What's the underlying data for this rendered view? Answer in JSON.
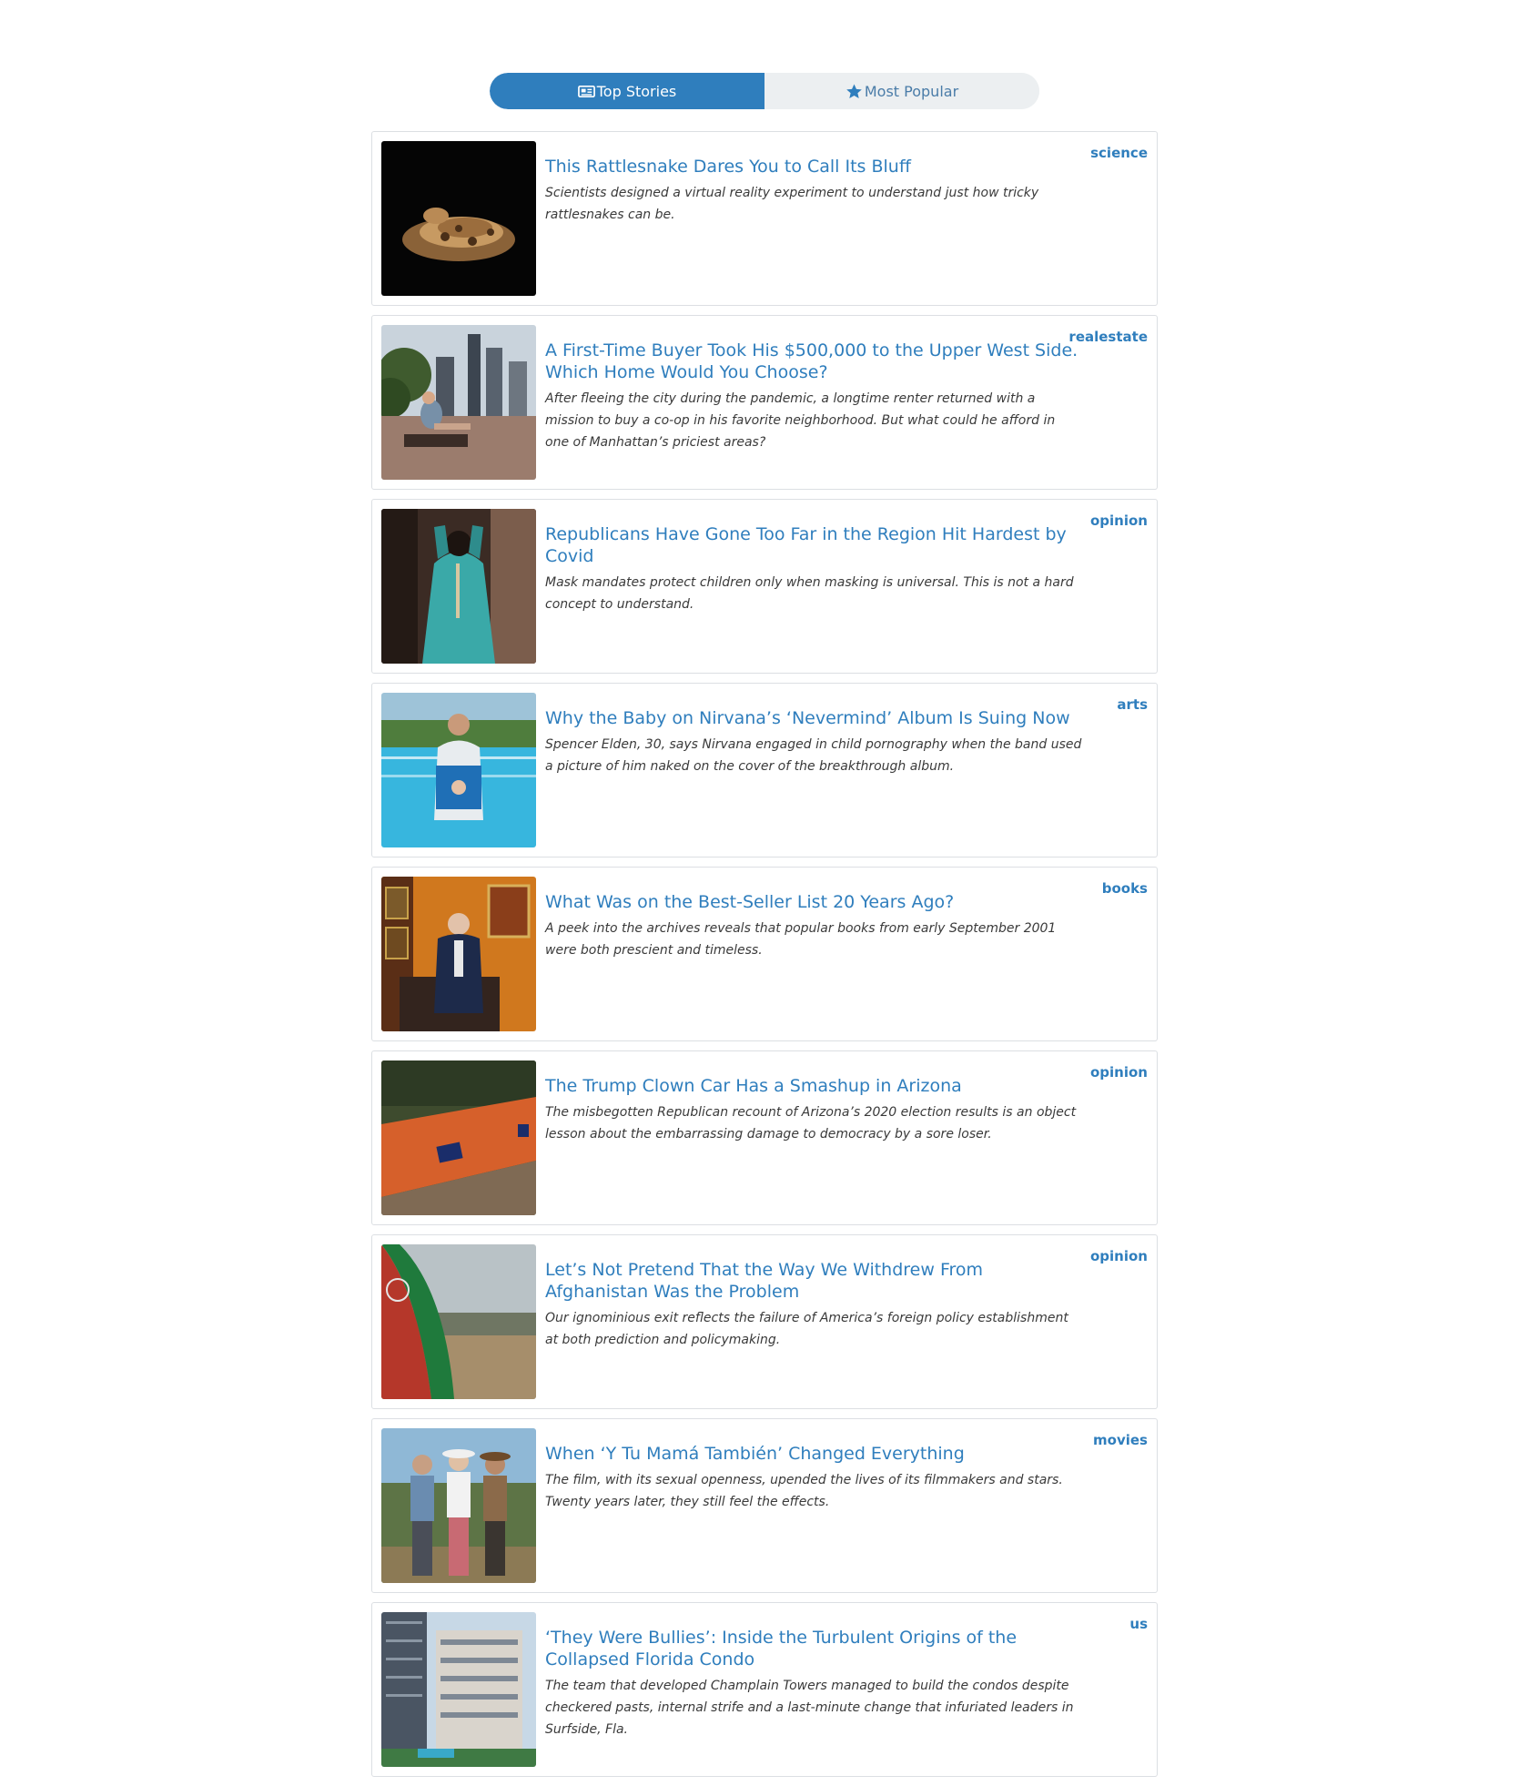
{
  "tabs": [
    {
      "label": "Top Stories",
      "icon": "newspaper-icon",
      "active": true
    },
    {
      "label": "Most Popular",
      "icon": "star-icon",
      "active": false
    }
  ],
  "colors": {
    "accent": "#2f7ebd",
    "tab_inactive_bg": "#eceff1",
    "card_border": "#dcdfe3"
  },
  "articles": [
    {
      "title": "This Rattlesnake Dares You to Call Its Bluff",
      "abstract": "Scientists designed a virtual reality experiment to understand just how tricky rattlesnakes can be.",
      "section": "science"
    },
    {
      "title": "A First-Time Buyer Took His $500,000 to the Upper West Side. Which Home Would You Choose?",
      "abstract": "After fleeing the city during the pandemic, a longtime renter returned with a mission to buy a co-op in his favorite neighborhood. But what could he afford in one of Manhattan’s priciest areas?",
      "section": "realestate"
    },
    {
      "title": "Republicans Have Gone Too Far in the Region Hit Hardest by Covid",
      "abstract": "Mask mandates protect children only when masking is universal. This is not a hard concept to understand.",
      "section": "opinion"
    },
    {
      "title": "Why the Baby on Nirvana’s ‘Nevermind’ Album Is Suing Now",
      "abstract": "Spencer Elden, 30, says Nirvana engaged in child pornography when the band used a picture of him naked on the cover of the breakthrough album.",
      "section": "arts"
    },
    {
      "title": "What Was on the Best-Seller List 20 Years Ago?",
      "abstract": "A peek into the archives reveals that popular books from early September 2001 were both prescient and timeless.",
      "section": "books"
    },
    {
      "title": "The Trump Clown Car Has a Smashup in Arizona",
      "abstract": "The misbegotten Republican recount of Arizona’s 2020 election results is an object lesson about the embarrassing damage to democracy by a sore loser.",
      "section": "opinion"
    },
    {
      "title": "Let’s Not Pretend That the Way We Withdrew From Afghanistan Was the Problem",
      "abstract": "Our ignominious exit reflects the failure of America’s foreign policy establishment at both prediction and policymaking.",
      "section": "opinion"
    },
    {
      "title": "When ‘Y Tu Mamá También’ Changed Everything",
      "abstract": "The film, with its sexual openness, upended the lives of its filmmakers and stars. Twenty years later, they still feel the effects.",
      "section": "movies"
    },
    {
      "title": "‘They Were Bullies’: Inside the Turbulent Origins of the Collapsed Florida Condo",
      "abstract": "The team that developed Champlain Towers managed to build the condos despite checkered pasts, internal strife and a last-minute change that infuriated leaders in Surfside, Fla.",
      "section": "us"
    }
  ]
}
